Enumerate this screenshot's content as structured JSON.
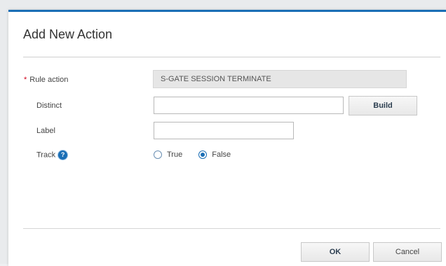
{
  "dialog": {
    "title": "Add New Action"
  },
  "form": {
    "rule_action": {
      "label": "Rule action",
      "required_marker": "*",
      "value": "S-GATE SESSION TERMINATE"
    },
    "distinct": {
      "label": "Distinct",
      "value": "",
      "build_label": "Build"
    },
    "label_field": {
      "label": "Label",
      "value": ""
    },
    "track": {
      "label": "Track",
      "help_glyph": "?",
      "options": [
        "True",
        "False"
      ],
      "selected": "False"
    }
  },
  "footer": {
    "ok_label": "OK",
    "cancel_label": "Cancel"
  },
  "colors": {
    "accent": "#1a6eb5",
    "required": "#d0021b"
  },
  "icons": {
    "help": "help-icon"
  }
}
